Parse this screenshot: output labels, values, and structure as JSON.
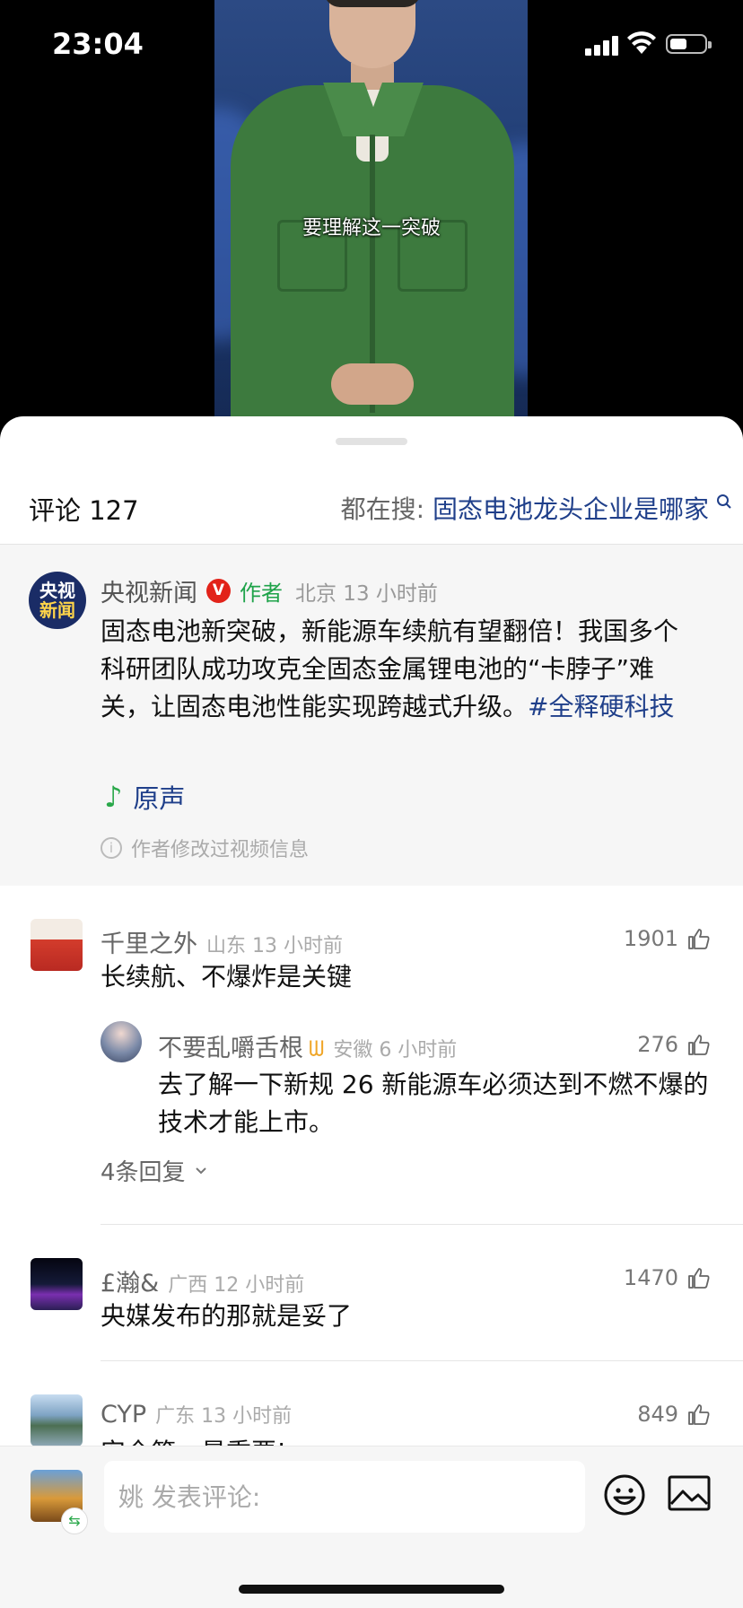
{
  "status_bar": {
    "time": "23:04"
  },
  "video": {
    "subtitle": "要理解这一突破"
  },
  "header": {
    "title": "评论 127",
    "search_prefix": "都在搜: ",
    "search_query": "固态电池龙头企业是哪家"
  },
  "description": {
    "author_name": "央视新闻",
    "badge": "V",
    "author_tag": "作者",
    "location_time": "北京 13 小时前",
    "avatar_text": [
      "央视",
      "新闻"
    ],
    "text": "固态电池新突破，新能源车续航有望翻倍！我国多个科研团队成功攻克全固态金属锂电池的“卡脖子”难关，让固态电池性能实现跨越式升级。",
    "hashtag": "#全释硬科技",
    "music": "原声",
    "modified_note": "作者修改过视频信息"
  },
  "comments": [
    {
      "name": "千里之外",
      "location_time": "山东 13 小时前",
      "likes": "1901",
      "text": "长续航、不爆炸是关键",
      "reply": {
        "name": "不要乱嚼舌根",
        "location_time": "安徽 6 小时前",
        "likes": "276",
        "text": "去了解一下新规 26 新能源车必须达到不燃不爆的技术才能上市。"
      },
      "replies_label": "4条回复"
    },
    {
      "name": "£瀚&",
      "location_time": "广西 12 小时前",
      "likes": "1470",
      "text": "央媒发布的那就是妥了"
    },
    {
      "name": "CYP",
      "location_time": "广东 13 小时前",
      "likes": "849",
      "text": "安全第一最重要!"
    }
  ],
  "composer": {
    "placeholder": "姚 发表评论:",
    "value": ""
  },
  "icons": {
    "like": "thumbs-up-icon",
    "emoji": "smiley-icon",
    "image": "image-icon",
    "search": "search-icon",
    "music": "music-note-icon",
    "info": "info-icon"
  },
  "colors": {
    "link_blue": "#1f3f8a",
    "author_green": "#1fa34a",
    "verified_red": "#e2231a",
    "gold_badge": "#f0a628"
  }
}
